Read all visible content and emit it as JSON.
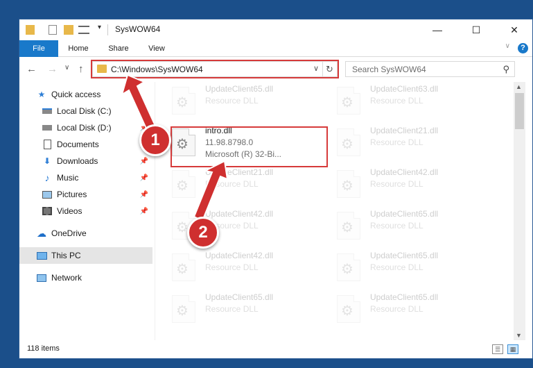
{
  "window": {
    "title": "SysWOW64",
    "minimize_glyph": "—",
    "maximize_glyph": "☐",
    "close_glyph": "✕"
  },
  "ribbon": {
    "tabs": [
      "File",
      "Home",
      "Share",
      "View"
    ],
    "help_label": "?"
  },
  "navigation": {
    "address_path": "C:\\Windows\\SysWOW64",
    "search_placeholder": "Search SysWOW64"
  },
  "sidebar": {
    "items": [
      {
        "label": "Quick access",
        "icon": "star-icon",
        "pinned": false
      },
      {
        "label": "Local Disk (C:)",
        "icon": "drive-icon",
        "pinned": true
      },
      {
        "label": "Local Disk (D:)",
        "icon": "drive-icon",
        "pinned": true
      },
      {
        "label": "Documents",
        "icon": "documents-icon",
        "pinned": true
      },
      {
        "label": "Downloads",
        "icon": "download-icon",
        "pinned": true
      },
      {
        "label": "Music",
        "icon": "music-icon",
        "pinned": true
      },
      {
        "label": "Pictures",
        "icon": "pictures-icon",
        "pinned": true
      },
      {
        "label": "Videos",
        "icon": "videos-icon",
        "pinned": true
      },
      {
        "label": "OneDrive",
        "icon": "cloud-icon",
        "pinned": false
      },
      {
        "label": "This PC",
        "icon": "computer-icon",
        "pinned": false
      },
      {
        "label": "Network",
        "icon": "network-icon",
        "pinned": false
      }
    ]
  },
  "files": {
    "highlighted": {
      "name": "intro.dll",
      "version": "11.98.8798.0",
      "description": "Microsoft (R) 32-Bi..."
    },
    "left_column": [
      {
        "name": "UpdateClient65.dll",
        "type": "Resource DLL"
      },
      {
        "name": "UpdateClient21.dll",
        "type": "Resource DLL"
      },
      {
        "name": "UpdateClient42.dll",
        "type": "Resource DLL"
      },
      {
        "name": "UpdateClient42.dll",
        "type": "Resource DLL"
      },
      {
        "name": "UpdateClient65.dll",
        "type": "Resource DLL"
      }
    ],
    "right_column": [
      {
        "name": "UpdateClient63.dll",
        "type": "Resource DLL"
      },
      {
        "name": "UpdateClient21.dll",
        "type": "Resource DLL"
      },
      {
        "name": "UpdateClient42.dll",
        "type": "Resource DLL"
      },
      {
        "name": "UpdateClient65.dll",
        "type": "Resource DLL"
      },
      {
        "name": "UpdateClient65.dll",
        "type": "Resource DLL"
      },
      {
        "name": "UpdateClient65.dll",
        "type": "Resource DLL"
      }
    ]
  },
  "status": {
    "item_count": "118 items"
  },
  "annotations": {
    "step1": "1",
    "step2": "2"
  },
  "colors": {
    "accent": "#1979ca",
    "highlight_red": "#d63a3a",
    "badge_red": "#cf2f2f",
    "desktop": "#1b4f8a"
  }
}
